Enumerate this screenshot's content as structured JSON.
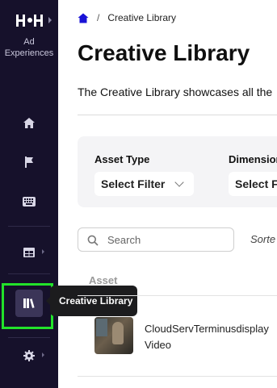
{
  "sidebar": {
    "brand": "Ad\nExperiences",
    "items": [
      {
        "icon": "home-icon"
      },
      {
        "icon": "flag-icon"
      },
      {
        "icon": "keyboard-icon"
      },
      {
        "icon": "table-icon"
      },
      {
        "icon": "library-icon",
        "active": true
      },
      {
        "icon": "gear-icon"
      }
    ],
    "tooltip": "Creative Library"
  },
  "breadcrumb": {
    "home_icon": "home-icon",
    "current": "Creative Library"
  },
  "page": {
    "title": "Creative Library",
    "description": "The Creative Library showcases all the"
  },
  "filters": [
    {
      "label": "Asset Type",
      "value": "Select Filter"
    },
    {
      "label": "Dimension",
      "value": "Select Fi"
    }
  ],
  "search": {
    "placeholder": "Search"
  },
  "sorted_label": "Sorte",
  "table": {
    "column_header": "Asset",
    "rows": [
      {
        "name": "CloudServTerminusdisplay",
        "type": "Video"
      }
    ]
  },
  "colors": {
    "sidebar_bg": "#16112b",
    "focus_ring": "#22e22a",
    "accent": "#1a13d6"
  }
}
